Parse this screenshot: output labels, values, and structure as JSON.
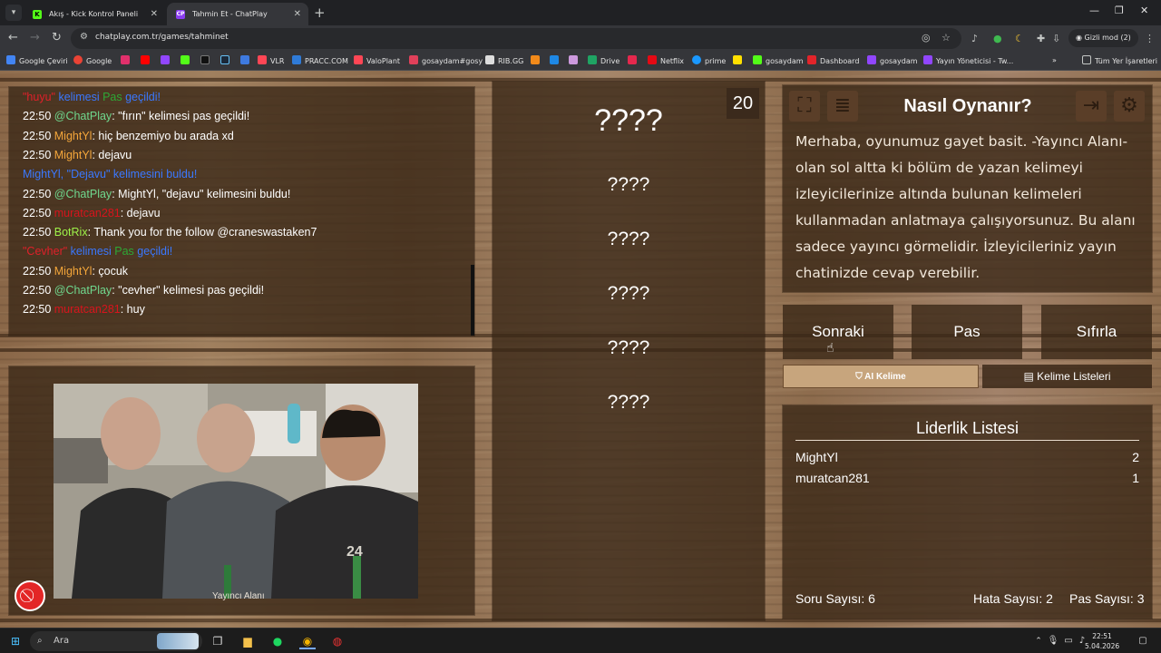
{
  "browser": {
    "tabs": [
      {
        "title": "Akış - Kick Kontrol Paneli",
        "favicon": "kick-icon"
      },
      {
        "title": "Tahmin Et - ChatPlay",
        "favicon": "chatplay-icon"
      }
    ],
    "url": "chatplay.com.tr/games/tahminet",
    "incognito_label": "Gizli mod (2)",
    "bookmarks": [
      "Google Çeviri",
      "Google",
      "VLR",
      "PRACC.COM",
      "ValoPlant",
      "gosaydam#gosy",
      "RIB.GG",
      "Drive",
      "Netflix",
      "prime",
      "gosaydam",
      "Dashboard",
      "gosaydam",
      "Yayın Yöneticisi - Tw...",
      "Tüm Yer İşaretleri"
    ]
  },
  "chat": {
    "lines": [
      {
        "time": "",
        "name": "\"huyu\"",
        "name_color": "#e0202a",
        "text": " kelimesi ",
        "extra": "Pas",
        "extra_color": "#2ea836",
        "tail": " geçildi!",
        "text_color": "#3a78ff"
      },
      {
        "time": "22:50 ",
        "name": "@ChatPlay",
        "name_color": "#6fd88e",
        "text": ": \"fırın\" kelimesi pas geçildi!"
      },
      {
        "time": "22:50 ",
        "name": "MightYl",
        "name_color": "#f4a63a",
        "text": ": hiç benzemiyo bu arada xd"
      },
      {
        "time": "22:50 ",
        "name": "MightYl",
        "name_color": "#f4a63a",
        "text": ": dejavu"
      },
      {
        "time": "",
        "name": "MightYl, \"Dejavu\"",
        "name_color": "#3a78ff",
        "text": " kelimesini buldu!",
        "text_color": "#3a78ff"
      },
      {
        "time": "22:50 ",
        "name": "@ChatPlay",
        "name_color": "#6fd88e",
        "text": ": MightYl, \"dejavu\" kelimesini buldu!"
      },
      {
        "time": "22:50 ",
        "name": "muratcan281",
        "name_color": "#d7141c",
        "text": ": dejavu"
      },
      {
        "time": "22:50 ",
        "name": "BotRix",
        "name_color": "#9ef34a",
        "text": ": Thank you for the follow @craneswastaken7"
      },
      {
        "time": "",
        "name": "\"Cevher\"",
        "name_color": "#e0202a",
        "text": " kelimesi ",
        "extra": "Pas",
        "extra_color": "#2ea836",
        "tail": " geçildi!",
        "text_color": "#3a78ff"
      },
      {
        "time": "22:50 ",
        "name": "MightYl",
        "name_color": "#f4a63a",
        "text": ": çocuk"
      },
      {
        "time": "22:50 ",
        "name": "@ChatPlay",
        "name_color": "#6fd88e",
        "text": ": \"cevher\" kelimesi pas geçildi!"
      },
      {
        "time": "22:50 ",
        "name": "muratcan281",
        "name_color": "#d7141c",
        "text": ": huy"
      }
    ]
  },
  "stream": {
    "label": "Yayıncı Alanı"
  },
  "words": {
    "counter": "20",
    "main": "????",
    "hidden": [
      "????",
      "????",
      "????",
      "????",
      "????"
    ]
  },
  "info": {
    "title": "Nasıl Oynanır?",
    "text": "Merhaba, oyunumuz gayet basit. -Yayıncı Alanı- olan sol altta ki bölüm de yazan kelimeyi izleyicilerinize altında bulunan kelimeleri kullanmadan anlatmaya çalışıyorsunuz. Bu alanı sadece yayıncı görmelidir. İzleyicileriniz yayın chatinizde cevap verebilir."
  },
  "actions": {
    "next": "Sonraki",
    "pass": "Pas",
    "reset": "Sıfırla",
    "ai_word": "AI Kelime",
    "word_lists": "Kelime Listeleri"
  },
  "leaderboard": {
    "title": "Liderlik Listesi",
    "rows": [
      {
        "name": "MightYl",
        "score": "2"
      },
      {
        "name": "muratcan281",
        "score": "1"
      }
    ]
  },
  "stats": {
    "questions_label": "Soru Sayısı: 6",
    "errors_label": "Hata Sayısı: 2",
    "passes_label": "Pas Sayısı: 3"
  },
  "taskbar": {
    "search_placeholder": "Ara",
    "time": "22:51",
    "date": "5.04.2026"
  },
  "colors": {
    "accent_red": "#e32626",
    "panel": "#382616"
  }
}
